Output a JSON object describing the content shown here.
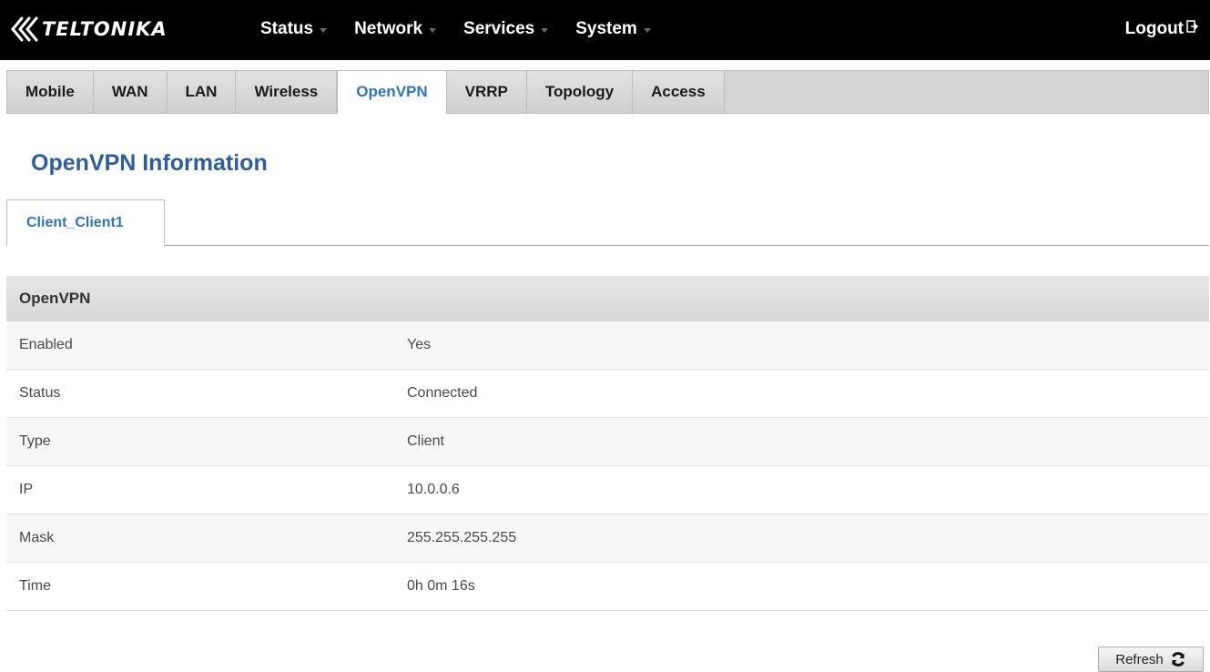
{
  "brand": {
    "name": "TELTONIKA"
  },
  "nav": {
    "items": [
      {
        "label": "Status"
      },
      {
        "label": "Network"
      },
      {
        "label": "Services"
      },
      {
        "label": "System"
      }
    ],
    "logout": "Logout"
  },
  "subtabs": [
    {
      "label": "Mobile"
    },
    {
      "label": "WAN"
    },
    {
      "label": "LAN"
    },
    {
      "label": "Wireless"
    },
    {
      "label": "OpenVPN",
      "active": true
    },
    {
      "label": "VRRP"
    },
    {
      "label": "Topology"
    },
    {
      "label": "Access"
    }
  ],
  "page": {
    "title": "OpenVPN Information",
    "client_tab": "Client_Client1"
  },
  "table": {
    "header": "OpenVPN",
    "rows": [
      {
        "label": "Enabled",
        "value": "Yes"
      },
      {
        "label": "Status",
        "value": "Connected"
      },
      {
        "label": "Type",
        "value": "Client"
      },
      {
        "label": "IP",
        "value": "10.0.0.6"
      },
      {
        "label": "Mask",
        "value": "255.255.255.255"
      },
      {
        "label": "Time",
        "value": "0h 0m 16s"
      }
    ]
  },
  "refresh_label": "Refresh",
  "colors": {
    "accent": "#2f74c4",
    "title": "#2c5e9e",
    "topbar": "#000000"
  },
  "icons": {
    "logout": "logout-icon",
    "refresh": "refresh-icon",
    "logo": "teltonika-logo-icon"
  }
}
